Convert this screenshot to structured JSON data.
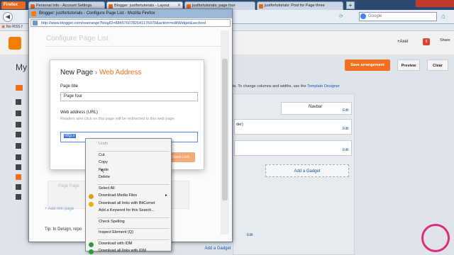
{
  "browser": {
    "app_button": "Firefox",
    "tabs": [
      {
        "label": "Personal Info - Account Settings"
      },
      {
        "label": "Blogger: justfortutorials - Layout"
      },
      {
        "label": "justfortutorials: page four"
      },
      {
        "label": "justfortutorials: Post for Page three"
      }
    ],
    "google_placeholder": "Google",
    "bookmark": "No RSS f"
  },
  "blogger": {
    "user": "+Axel",
    "notification_count": "9",
    "share_label": "Share",
    "my_label": "My",
    "save_arrangement": "Save arrangement",
    "preview": "Preview",
    "clear": "Clear",
    "hint_text": "ts. To change columns and widths, use the",
    "hint_link": "Template Designer",
    "navbar_label": "Navbar",
    "edit": "Edit",
    "add_gadget": "Add a Gadget",
    "fragment_der": "der)"
  },
  "popup": {
    "title": "Blogger: justfortutorials - Configure Page List - Mozilla Firefox",
    "url": "http://www.blogger.com/rearrange?blogID=8849760782641176970&action=editWidget&sectionI",
    "heading": "Configure Page List",
    "page_label": "Page Page",
    "add_link": "+ Add link page",
    "tip": "Tip: In Design, repo",
    "edit_short": "Edit",
    "save_link": "Save Link"
  },
  "dialog": {
    "crumb_first": "New Page",
    "crumb_sep": "›",
    "crumb_second": "Web Address",
    "page_title_label": "Page title",
    "page_title_value": "Page four",
    "web_address_label": "Web address (URL)",
    "web_address_hint": "Readers who click on this page will be redirected to this web page.",
    "web_address_value": "http://"
  },
  "context_menu": [
    {
      "label": "Undo",
      "disabled": true
    },
    {
      "sep": true
    },
    {
      "label": "Cut"
    },
    {
      "label": "Copy"
    },
    {
      "label": "Paste"
    },
    {
      "label": "Delete"
    },
    {
      "sep": true
    },
    {
      "label": "Select All"
    },
    {
      "label": "Download Media Files",
      "submenu": true
    },
    {
      "label": "Download all links with BitComet"
    },
    {
      "label": "Add a Keyword for this Search..."
    },
    {
      "sep": true
    },
    {
      "label": "Check Spelling"
    },
    {
      "sep": true
    },
    {
      "label": "Inspect Element (Q)"
    },
    {
      "sep": true
    },
    {
      "label": "Download with IDM"
    },
    {
      "label": "Download all links with IDM"
    }
  ],
  "colors": {
    "accent": "#f0701f",
    "link": "#1a55a8",
    "chrome": "#2c4a6f"
  }
}
